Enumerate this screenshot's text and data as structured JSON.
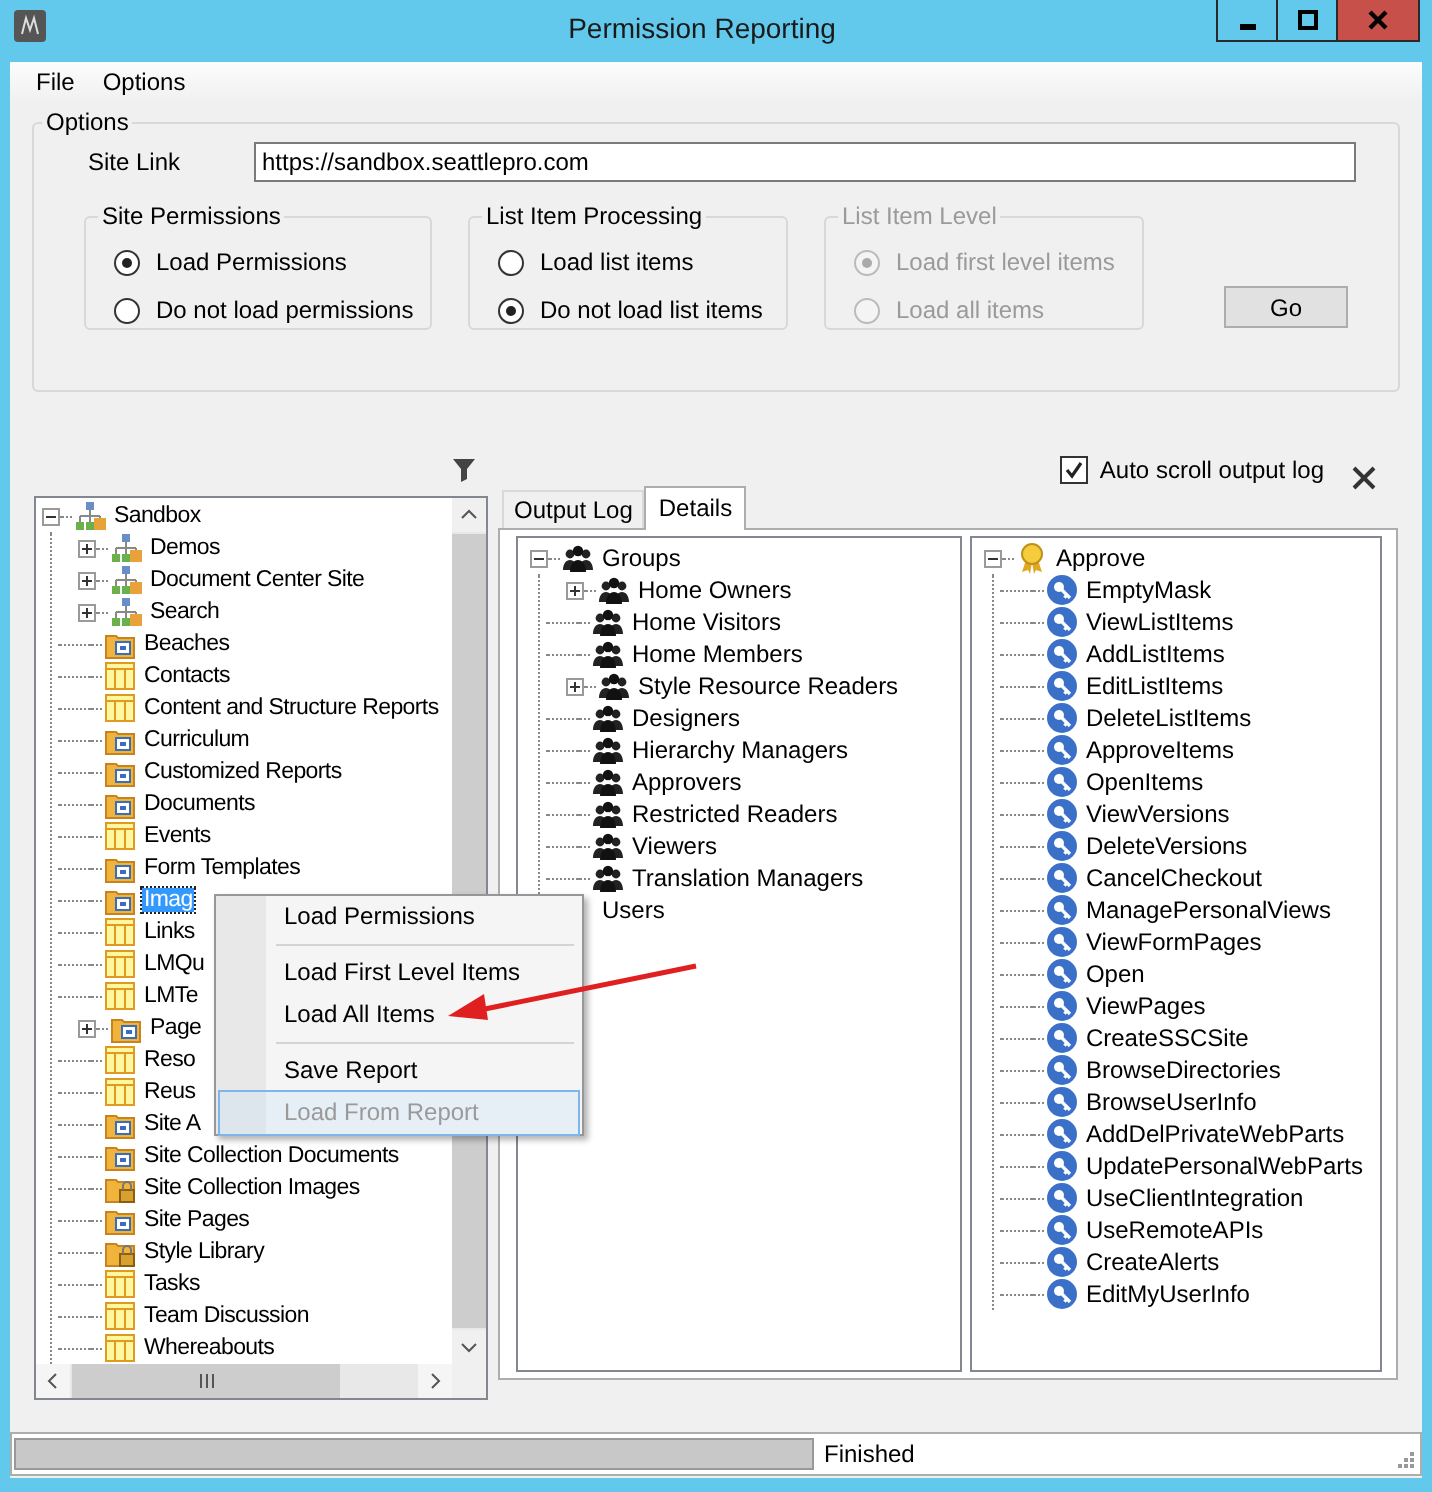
{
  "window": {
    "title": "Permission Reporting"
  },
  "menu": [
    "File",
    "Options"
  ],
  "options": {
    "title": "Options",
    "site_link": {
      "label": "Site Link",
      "value": "https://sandbox.seattlepro.com"
    },
    "groups": [
      {
        "title": "Site Permissions",
        "disabled": false,
        "radios": [
          {
            "label": "Load Permissions",
            "selected": true
          },
          {
            "label": "Do not load permissions",
            "selected": false
          }
        ]
      },
      {
        "title": "List Item Processing",
        "disabled": false,
        "radios": [
          {
            "label": "Load list items",
            "selected": false
          },
          {
            "label": "Do not load list items",
            "selected": true
          }
        ]
      },
      {
        "title": "List Item Level",
        "disabled": true,
        "radios": [
          {
            "label": "Load first level items",
            "selected": true
          },
          {
            "label": "Load all items",
            "selected": false
          }
        ]
      }
    ],
    "go_button": "Go"
  },
  "auto_scroll": {
    "label": "Auto scroll output log",
    "checked": true
  },
  "site_tree": [
    {
      "label": "Sandbox",
      "kind": "site",
      "expanded": true,
      "selected": false,
      "children": [
        {
          "label": "Demos",
          "kind": "site",
          "expanded": false,
          "selected": false
        },
        {
          "label": "Document Center Site",
          "kind": "site",
          "expanded": false,
          "selected": false
        },
        {
          "label": "Search",
          "kind": "site",
          "expanded": false,
          "selected": false
        },
        {
          "label": "Beaches",
          "kind": "library",
          "selected": false
        },
        {
          "label": "Contacts",
          "kind": "list",
          "selected": false
        },
        {
          "label": "Content and Structure Reports",
          "kind": "list",
          "selected": false
        },
        {
          "label": "Curriculum",
          "kind": "library",
          "selected": false
        },
        {
          "label": "Customized Reports",
          "kind": "library",
          "selected": false
        },
        {
          "label": "Documents",
          "kind": "library",
          "selected": false
        },
        {
          "label": "Events",
          "kind": "list",
          "selected": false
        },
        {
          "label": "Form Templates",
          "kind": "library",
          "selected": false
        },
        {
          "label": "Imag",
          "kind": "library",
          "selected": true
        },
        {
          "label": "Links",
          "kind": "list",
          "selected": false
        },
        {
          "label": "LMQu",
          "kind": "list",
          "selected": false
        },
        {
          "label": "LMTe",
          "kind": "list",
          "selected": false
        },
        {
          "label": "Page",
          "kind": "library",
          "expanded": false,
          "selected": false
        },
        {
          "label": "Reso",
          "kind": "list",
          "selected": false
        },
        {
          "label": "Reus",
          "kind": "list",
          "selected": false
        },
        {
          "label": "Site A",
          "kind": "library",
          "selected": false
        },
        {
          "label": "Site Collection Documents",
          "kind": "library",
          "selected": false
        },
        {
          "label": "Site Collection Images",
          "kind": "locked-library",
          "selected": false
        },
        {
          "label": "Site Pages",
          "kind": "library",
          "selected": false
        },
        {
          "label": "Style Library",
          "kind": "locked-library",
          "selected": false
        },
        {
          "label": "Tasks",
          "kind": "list",
          "selected": false
        },
        {
          "label": "Team Discussion",
          "kind": "list",
          "selected": false
        },
        {
          "label": "Whereabouts",
          "kind": "list",
          "selected": false
        }
      ]
    }
  ],
  "tabs": [
    {
      "label": "Output Log",
      "selected": false
    },
    {
      "label": "Details",
      "selected": true
    }
  ],
  "groups_tree": [
    {
      "label": "Groups",
      "kind": "group",
      "expanded": true,
      "children": [
        {
          "label": "Home Owners",
          "kind": "group",
          "expanded": false
        },
        {
          "label": "Home Visitors",
          "kind": "group"
        },
        {
          "label": "Home Members",
          "kind": "group"
        },
        {
          "label": "Style Resource Readers",
          "kind": "group",
          "expanded": false
        },
        {
          "label": "Designers",
          "kind": "group"
        },
        {
          "label": "Hierarchy Managers",
          "kind": "group"
        },
        {
          "label": "Approvers",
          "kind": "group"
        },
        {
          "label": "Restricted Readers",
          "kind": "group"
        },
        {
          "label": "Viewers",
          "kind": "group"
        },
        {
          "label": "Translation Managers",
          "kind": "group"
        }
      ]
    },
    {
      "label": "Users"
    }
  ],
  "permissions_tree": [
    {
      "label": "Approve",
      "kind": "permission-level",
      "expanded": true,
      "children": [
        {
          "label": "EmptyMask",
          "kind": "permission"
        },
        {
          "label": "ViewListItems",
          "kind": "permission"
        },
        {
          "label": "AddListItems",
          "kind": "permission"
        },
        {
          "label": "EditListItems",
          "kind": "permission"
        },
        {
          "label": "DeleteListItems",
          "kind": "permission"
        },
        {
          "label": "ApproveItems",
          "kind": "permission"
        },
        {
          "label": "OpenItems",
          "kind": "permission"
        },
        {
          "label": "ViewVersions",
          "kind": "permission"
        },
        {
          "label": "DeleteVersions",
          "kind": "permission"
        },
        {
          "label": "CancelCheckout",
          "kind": "permission"
        },
        {
          "label": "ManagePersonalViews",
          "kind": "permission"
        },
        {
          "label": "ViewFormPages",
          "kind": "permission"
        },
        {
          "label": "Open",
          "kind": "permission"
        },
        {
          "label": "ViewPages",
          "kind": "permission"
        },
        {
          "label": "CreateSSCSite",
          "kind": "permission"
        },
        {
          "label": "BrowseDirectories",
          "kind": "permission"
        },
        {
          "label": "BrowseUserInfo",
          "kind": "permission"
        },
        {
          "label": "AddDelPrivateWebParts",
          "kind": "permission"
        },
        {
          "label": "UpdatePersonalWebParts",
          "kind": "permission"
        },
        {
          "label": "UseClientIntegration",
          "kind": "permission"
        },
        {
          "label": "UseRemoteAPIs",
          "kind": "permission"
        },
        {
          "label": "CreateAlerts",
          "kind": "permission"
        },
        {
          "label": "EditMyUserInfo",
          "kind": "permission"
        }
      ]
    }
  ],
  "context_menu": [
    {
      "kind": "item",
      "label": "Load Permissions",
      "disabled": false,
      "highlighted": false
    },
    {
      "kind": "separator"
    },
    {
      "kind": "item",
      "label": "Load First Level Items",
      "disabled": false,
      "highlighted": false
    },
    {
      "kind": "item",
      "label": "Load All Items",
      "disabled": false,
      "highlighted": false
    },
    {
      "kind": "separator"
    },
    {
      "kind": "item",
      "label": "Save Report",
      "disabled": false,
      "highlighted": false
    },
    {
      "kind": "item",
      "label": "Load From Report",
      "disabled": true,
      "highlighted": true
    }
  ],
  "status_bar": {
    "progress": {
      "level": 0
    },
    "text": "Finished"
  }
}
